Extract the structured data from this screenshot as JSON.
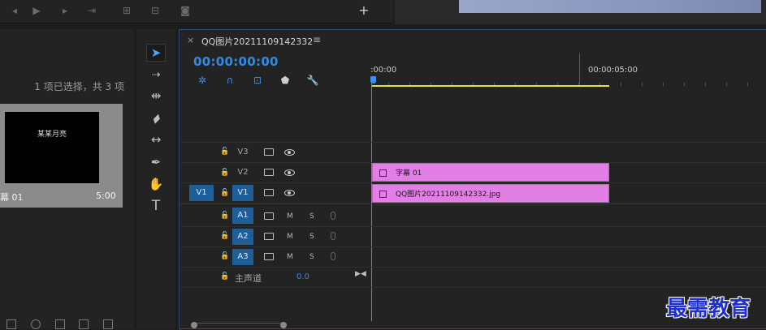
{
  "project": {
    "selection_info": "1 项已选择，共 3 项",
    "clip": {
      "thumbnail_text": "某某月亮",
      "name": "幕 01",
      "duration": "5:00"
    }
  },
  "timeline": {
    "close_glyph": "×",
    "sequence_name": "QQ图片20211109142332",
    "menu_glyph": "≡",
    "timecode": "00:00:00:00",
    "ruler": {
      "start_label": ":00:00",
      "mark_label": "00:00:05:00"
    },
    "tracks": {
      "video": [
        {
          "label": "V3",
          "clip": null
        },
        {
          "label": "V2",
          "clip": "字幕 01"
        },
        {
          "label": "V1",
          "clip": "QQ图片20211109142332.jpg",
          "source_label": "V1"
        }
      ],
      "audio": [
        {
          "label": "A1",
          "mute": "M",
          "solo": "S"
        },
        {
          "label": "A2",
          "mute": "M",
          "solo": "S"
        },
        {
          "label": "A3",
          "mute": "M",
          "solo": "S"
        }
      ]
    },
    "master": {
      "label": "主声道",
      "value": "0.0"
    }
  },
  "tools": [
    "selection-tool",
    "track-select-tool",
    "ripple-edit-tool",
    "razor-tool",
    "slip-tool",
    "pen-tool",
    "hand-tool",
    "type-tool"
  ],
  "colors": {
    "accent_blue": "#2d8ceb",
    "clip_pink": "#e27fe4",
    "work_area_yellow": "#e6e23a",
    "track_target": "#1e5f9a"
  },
  "watermark": "最需教育"
}
